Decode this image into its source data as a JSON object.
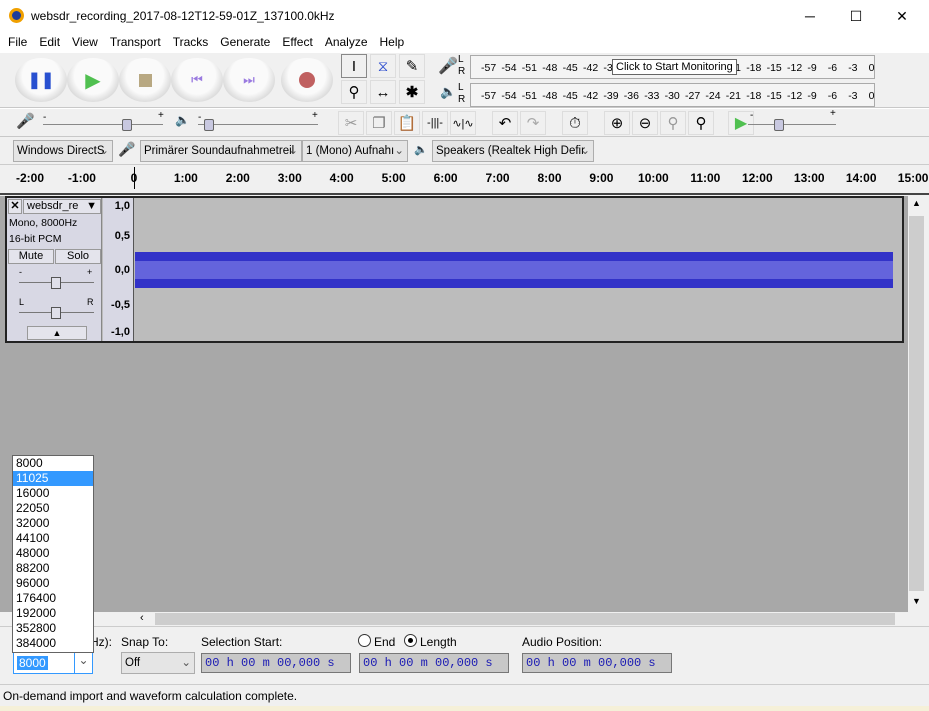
{
  "window": {
    "title": "websdr_recording_2017-08-12T12-59-01Z_137100.0kHz",
    "minimize": "─",
    "maximize": "☐",
    "close": "✕"
  },
  "menu": [
    "File",
    "Edit",
    "View",
    "Transport",
    "Tracks",
    "Generate",
    "Effect",
    "Analyze",
    "Help"
  ],
  "meters": {
    "scale": [
      "-57",
      "-54",
      "-51",
      "-48",
      "-45",
      "-42",
      "-39",
      "-36",
      "-33",
      "-30",
      "-27",
      "-24",
      "-21",
      "-18",
      "-15",
      "-12",
      "-9",
      "-6",
      "-3",
      "0"
    ],
    "tooltip": "Click to Start Monitoring",
    "L": "L",
    "R": "R"
  },
  "devices": {
    "host": "Windows DirectS",
    "input": "Primärer Soundaufnahmetreil",
    "channels": "1 (Mono) Aufnahı",
    "output": "Speakers (Realtek High Defir"
  },
  "slider": {
    "minus": "-",
    "plus": "+",
    "input_volume": 0.7,
    "output_volume": 0.05,
    "play_speed": 0.35
  },
  "ruler": [
    "-2:00",
    "-1:00",
    "0",
    "1:00",
    "2:00",
    "3:00",
    "4:00",
    "5:00",
    "6:00",
    "7:00",
    "8:00",
    "9:00",
    "10:00",
    "11:00",
    "12:00",
    "13:00",
    "14:00",
    "15:00"
  ],
  "track": {
    "name": "websdr_re",
    "info1": "Mono, 8000Hz",
    "info2": "16-bit PCM",
    "mute": "Mute",
    "solo": "Solo",
    "gain_minus": "-",
    "gain_plus": "+",
    "pan_l": "L",
    "pan_r": "R",
    "scale": [
      "1,0",
      "0,5",
      "0,0",
      "-0,5",
      "-1,0"
    ],
    "collapse": "▲"
  },
  "rate_list": [
    "8000",
    "11025",
    "16000",
    "22050",
    "32000",
    "44100",
    "48000",
    "88200",
    "96000",
    "176400",
    "192000",
    "352800",
    "384000"
  ],
  "rate_list_highlighted": "11025",
  "selection": {
    "rate_label": "Hz):",
    "rate_value": "8000",
    "snap_label": "Snap To:",
    "snap_value": "Off",
    "start_label": "Selection Start:",
    "end_label": "End",
    "length_label": "Length",
    "length_selected": true,
    "position_label": "Audio Position:",
    "time": "00 h 00 m 00,000 s"
  },
  "status": "On-demand import and waveform calculation complete.",
  "colors": {
    "waveform": "#3232c8",
    "waveform_rms": "#6464dc",
    "selection_highlight": "#3399ff"
  }
}
